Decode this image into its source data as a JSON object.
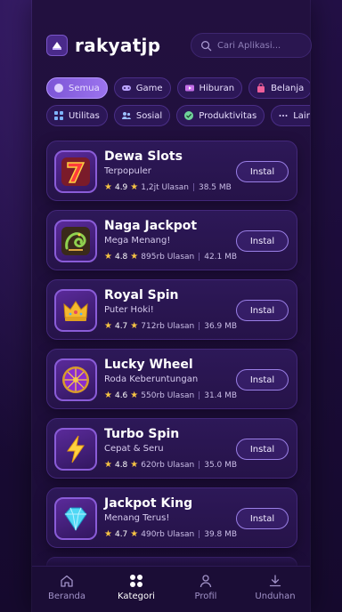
{
  "header": {
    "brand": "rakyatjp",
    "search_placeholder": "Cari Aplikasi..."
  },
  "chips_row1": [
    {
      "label": "Semua",
      "icon": "circle-icon",
      "active": true
    },
    {
      "label": "Game",
      "icon": "gamepad-icon",
      "active": false
    },
    {
      "label": "Hiburan",
      "icon": "video-icon",
      "active": false
    },
    {
      "label": "Belanja",
      "icon": "shopping-bag-icon",
      "active": false
    }
  ],
  "chips_row2": [
    {
      "label": "Utilitas",
      "icon": "grid-icon"
    },
    {
      "label": "Sosial",
      "icon": "users-icon"
    },
    {
      "label": "Produktivitas",
      "icon": "check-circle-icon"
    },
    {
      "label": "Lainnya",
      "icon": "more-icon"
    }
  ],
  "apps": [
    {
      "name": "Dewa Slots",
      "tagline": "Terpopuler",
      "rating": "4.9",
      "reviews": "1,2jt Ulasan",
      "size": "38.5 MB",
      "install": "Instal",
      "icon": "seven-icon"
    },
    {
      "name": "Naga Jackpot",
      "tagline": "Mega Menang!",
      "rating": "4.8",
      "reviews": "895rb Ulasan",
      "size": "42.1 MB",
      "install": "Instal",
      "icon": "dragon-icon"
    },
    {
      "name": "Royal Spin",
      "tagline": "Puter Hoki!",
      "rating": "4.7",
      "reviews": "712rb Ulasan",
      "size": "36.9 MB",
      "install": "Instal",
      "icon": "crown-icon"
    },
    {
      "name": "Lucky Wheel",
      "tagline": "Roda Keberuntungan",
      "rating": "4.6",
      "reviews": "550rb Ulasan",
      "size": "31.4 MB",
      "install": "Instal",
      "icon": "wheel-icon"
    },
    {
      "name": "Turbo Spin",
      "tagline": "Cepat & Seru",
      "rating": "4.8",
      "reviews": "620rb Ulasan",
      "size": "35.0 MB",
      "install": "Instal",
      "icon": "lightning-icon"
    },
    {
      "name": "Jackpot King",
      "tagline": "Menang Terus!",
      "rating": "4.7",
      "reviews": "490rb Ulasan",
      "size": "39.8 MB",
      "install": "Instal",
      "icon": "diamond-icon"
    }
  ],
  "nav": [
    {
      "label": "Beranda",
      "icon": "home-icon",
      "active": false
    },
    {
      "label": "Kategori",
      "icon": "categories-icon",
      "active": true
    },
    {
      "label": "Profil",
      "icon": "user-icon",
      "active": false
    },
    {
      "label": "Unduhan",
      "icon": "download-icon",
      "active": false
    }
  ]
}
